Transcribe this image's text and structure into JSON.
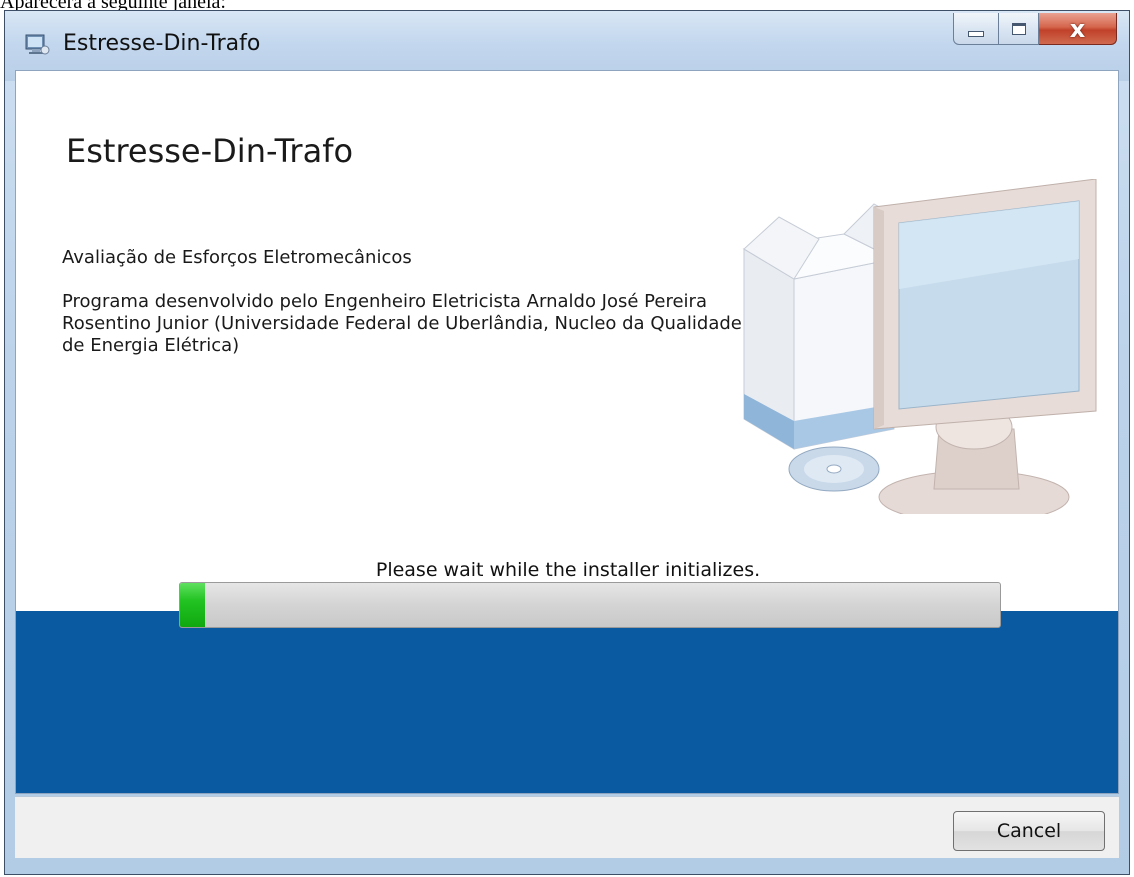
{
  "document": {
    "caption": "Aparecerá a seguinte janela:"
  },
  "window": {
    "title": "Estresse-Din-Trafo",
    "buttons": {
      "minimize_icon": "minimize-icon",
      "maximize_icon": "maximize-icon",
      "close_label": "x"
    }
  },
  "installer": {
    "heading": "Estresse-Din-Trafo",
    "subtitle": "Avaliação de Esforços Eletromecânicos",
    "description_lines": [
      "Programa desenvolvido pelo Engenheiro Eletricista Arnaldo José Pereira",
      "Rosentino Junior (Universidade Federal de Uberlândia, Nucleo da Qualidade",
      "de Energia Elétrica)"
    ],
    "illustration_icon": "computer-setup-icon",
    "status": "Please wait while the installer initializes.",
    "progress_fraction": 0.03
  },
  "footer": {
    "cancel_label": "Cancel"
  },
  "colors": {
    "band": "#0a5aa2",
    "progress": "#22c322"
  }
}
